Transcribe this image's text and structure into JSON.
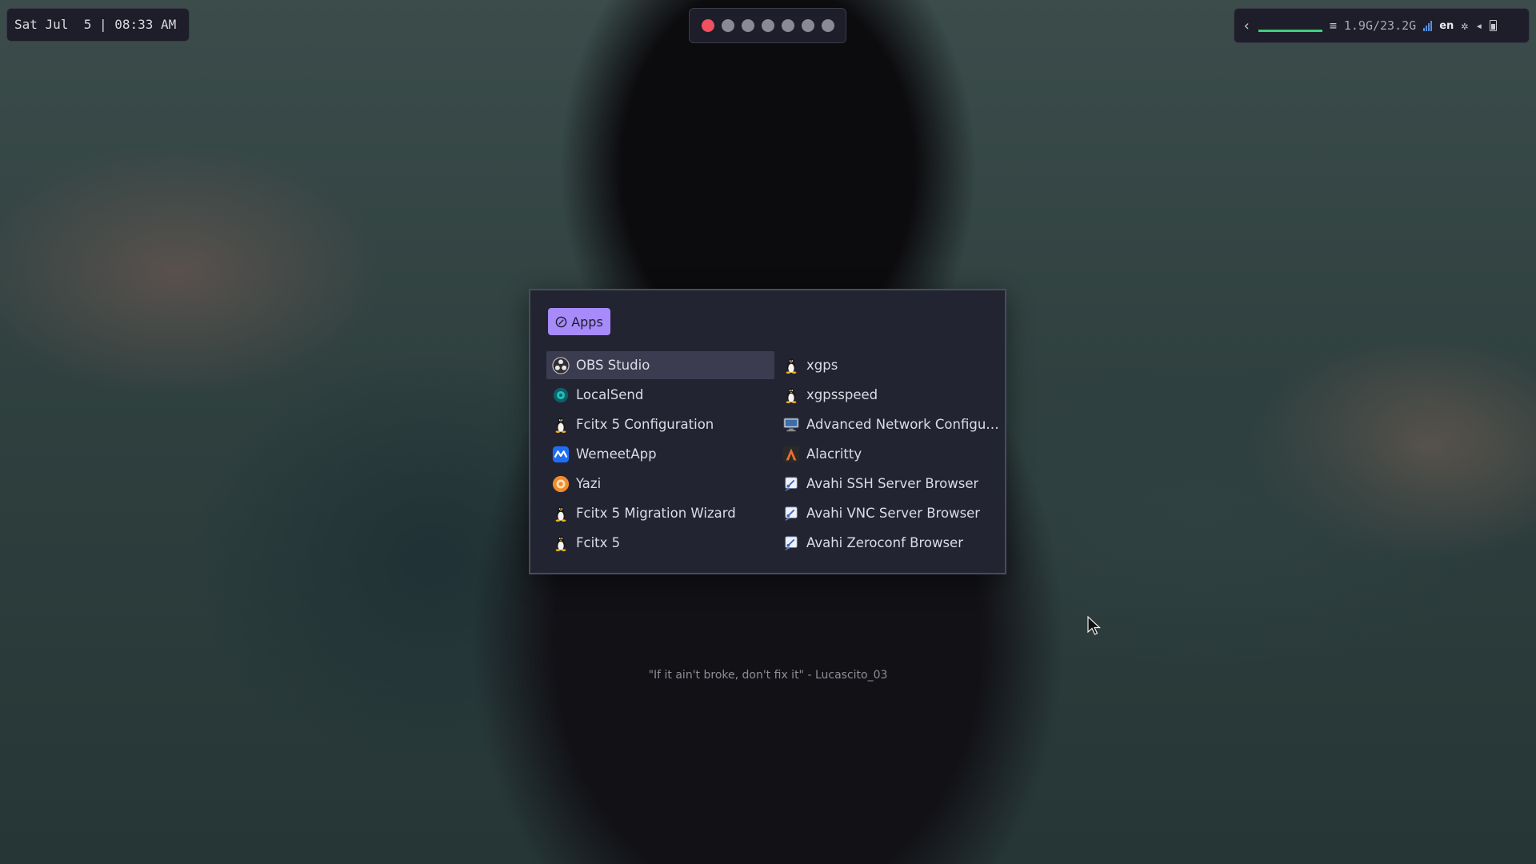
{
  "topbar": {
    "clock": "Sat Jul  5 | 08:33 AM",
    "workspaces": [
      {
        "id": 1,
        "active": true
      },
      {
        "id": 2,
        "active": false
      },
      {
        "id": 3,
        "active": false
      },
      {
        "id": 4,
        "active": false
      },
      {
        "id": 5,
        "active": false
      },
      {
        "id": 6,
        "active": false
      },
      {
        "id": 7,
        "active": false
      }
    ],
    "memory": "1.9G/23.2G",
    "language": "en",
    "colors": {
      "active_workspace": "#f05060",
      "cpu_graph": "#3fcf7f",
      "bar_bg": "#1e1e2a"
    }
  },
  "launcher": {
    "mode_label": "Apps",
    "accent": "#a78bfa",
    "left_column": [
      {
        "label": "OBS Studio",
        "icon": "obs-icon",
        "selected": true
      },
      {
        "label": "LocalSend",
        "icon": "localsend-icon"
      },
      {
        "label": "Fcitx 5 Configuration",
        "icon": "tux-icon"
      },
      {
        "label": "WemeetApp",
        "icon": "wemeet-icon"
      },
      {
        "label": "Yazi",
        "icon": "yazi-icon"
      },
      {
        "label": "Fcitx 5 Migration Wizard",
        "icon": "tux-icon"
      },
      {
        "label": "Fcitx 5",
        "icon": "tux-icon"
      }
    ],
    "right_column": [
      {
        "label": "xgps",
        "icon": "tux-icon"
      },
      {
        "label": "xgpsspeed",
        "icon": "tux-icon"
      },
      {
        "label": "Advanced Network Configurati...",
        "icon": "network-config-icon"
      },
      {
        "label": "Alacritty",
        "icon": "alacritty-icon"
      },
      {
        "label": "Avahi SSH Server Browser",
        "icon": "avahi-icon"
      },
      {
        "label": "Avahi VNC Server Browser",
        "icon": "avahi-icon"
      },
      {
        "label": "Avahi Zeroconf Browser",
        "icon": "avahi-icon"
      }
    ]
  },
  "desktop": {
    "quote": "\"If it ain't broke, don't fix it\" - Lucascito_03"
  }
}
